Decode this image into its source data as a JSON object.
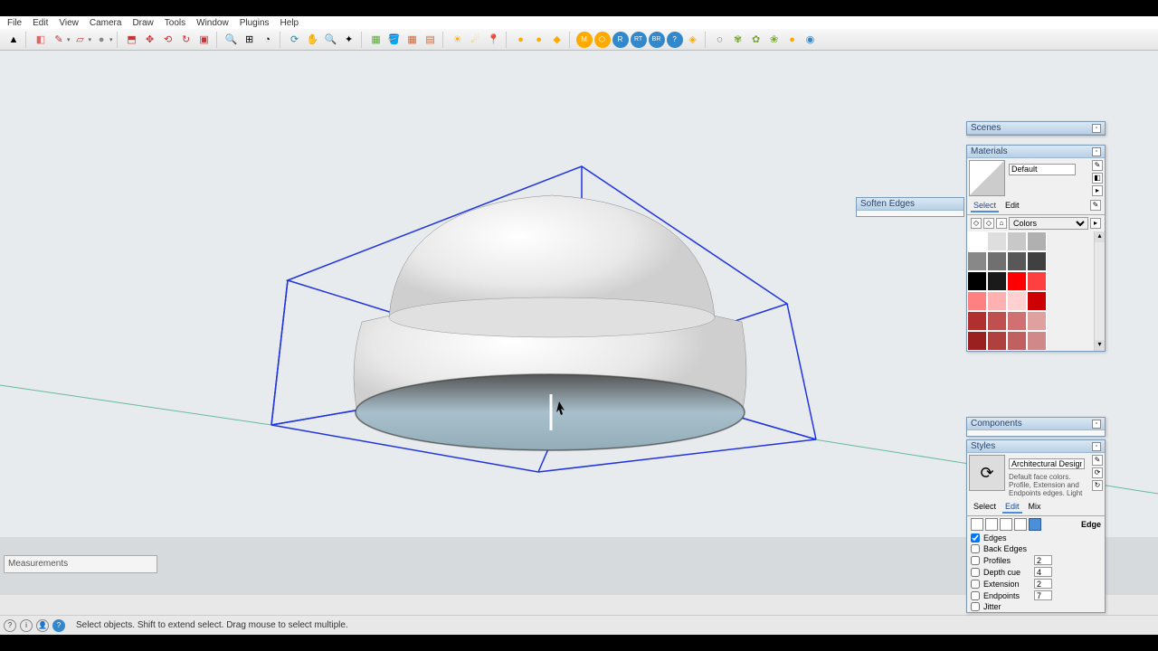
{
  "menu": [
    "File",
    "Edit",
    "View",
    "Camera",
    "Draw",
    "Tools",
    "Window",
    "Plugins",
    "Help"
  ],
  "panels": {
    "scenes": "Scenes",
    "materials": "Materials",
    "soften": "Soften Edges",
    "components": "Components",
    "styles": "Styles"
  },
  "materials": {
    "default_label": "Default",
    "tabs": {
      "select": "Select",
      "edit": "Edit"
    },
    "library": "Colors",
    "swatches": [
      [
        "#ffffff",
        "#dedede",
        "#c8c8c8",
        "#b0b0b0"
      ],
      [
        "#888888",
        "#707070",
        "#585858",
        "#404040"
      ],
      [
        "#000000",
        "#1a1a1a",
        "#ff0000",
        "#ff4040"
      ],
      [
        "#ff8080",
        "#ffb0b0",
        "#ffd0d0",
        "#cc0000"
      ],
      [
        "#b03030",
        "#c05050",
        "#d07070",
        "#e0a0a0"
      ],
      [
        "#9a2020",
        "#b04040",
        "#c06060",
        "#d08888"
      ]
    ]
  },
  "styles": {
    "name": "Architectural Design Style",
    "desc": "Default face colors. Profile, Extension and Endpoints edges. Light",
    "tabs": {
      "select": "Select",
      "edit": "Edit",
      "mix": "Mix"
    },
    "section": "Edge",
    "options": {
      "edges": {
        "label": "Edges",
        "checked": true
      },
      "back": {
        "label": "Back Edges",
        "checked": false
      },
      "profiles": {
        "label": "Profiles",
        "checked": false,
        "value": "2"
      },
      "depth": {
        "label": "Depth cue",
        "checked": false,
        "value": "4"
      },
      "extension": {
        "label": "Extension",
        "checked": false,
        "value": "2"
      },
      "endpoints": {
        "label": "Endpoints",
        "checked": false,
        "value": "7"
      },
      "jitter": {
        "label": "Jitter",
        "checked": false
      }
    }
  },
  "measurements_label": "Measurements",
  "status_hint": "Select objects. Shift to extend select. Drag mouse to select multiple."
}
